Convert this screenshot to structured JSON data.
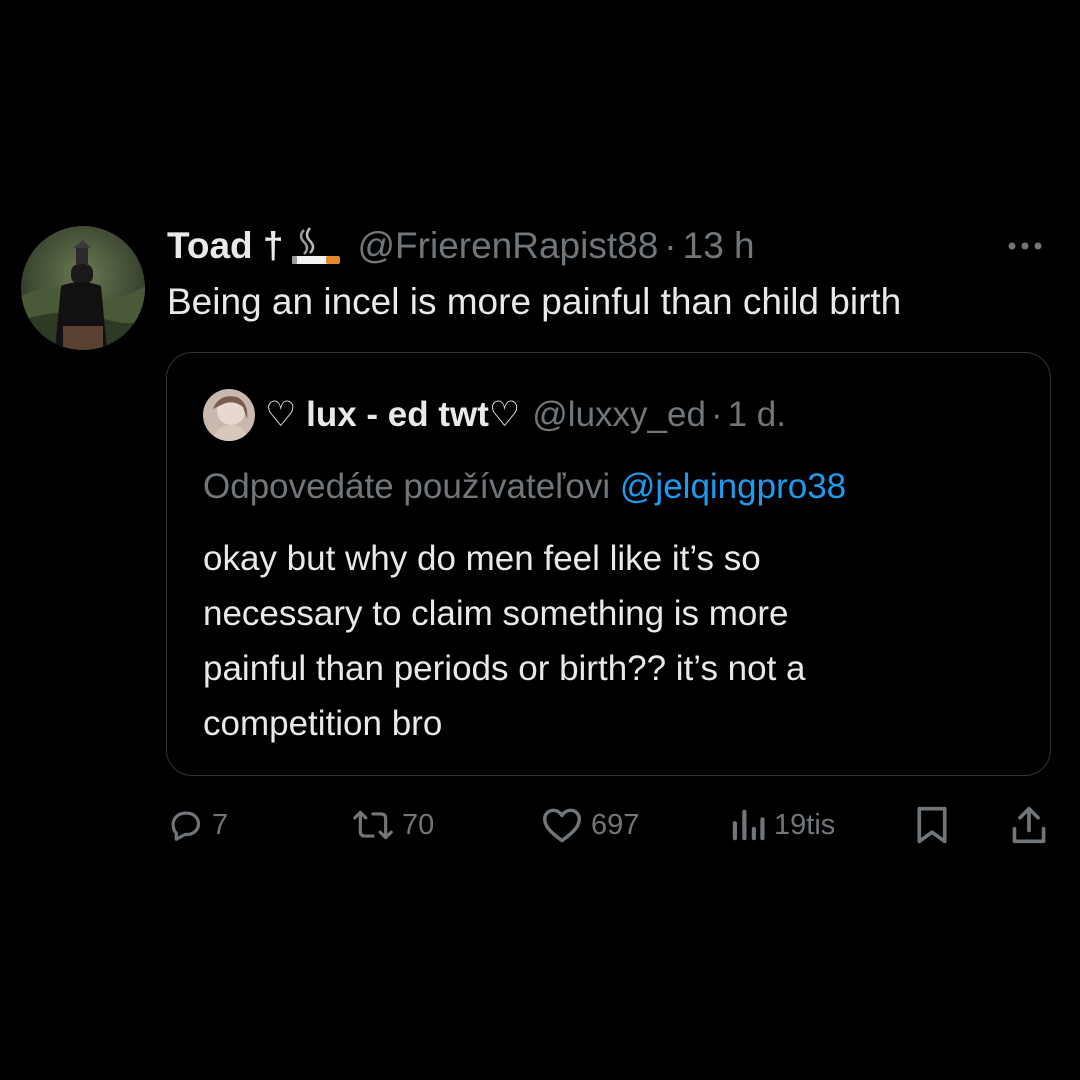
{
  "tweet": {
    "display_name": "Toad †",
    "name_emoji": "cigarette-emoji",
    "handle": "@FrierenRapist88",
    "separator": "·",
    "time": "13 h",
    "text": "Being an incel is more painful than child birth"
  },
  "quote": {
    "name_prefix": "♡ lux - ed twt♡",
    "handle": "@luxxy_ed",
    "separator": "·",
    "time": "1 d.",
    "reply_label": "Odpovedáte používateľovi",
    "reply_mention": "@jelqingpro38",
    "text_lines": [
      "okay but why do men feel like it’s so",
      "necessary to claim something is more",
      "painful than periods or birth?? it’s not a",
      "competition bro"
    ]
  },
  "actions": {
    "reply_count": "7",
    "retweet_count": "70",
    "like_count": "697",
    "views_count": "19tis"
  },
  "colors": {
    "background": "#000000",
    "text_primary": "#e7e9ea",
    "text_secondary": "#71767b",
    "link": "#1d9bf0",
    "border": "#2f3336"
  }
}
